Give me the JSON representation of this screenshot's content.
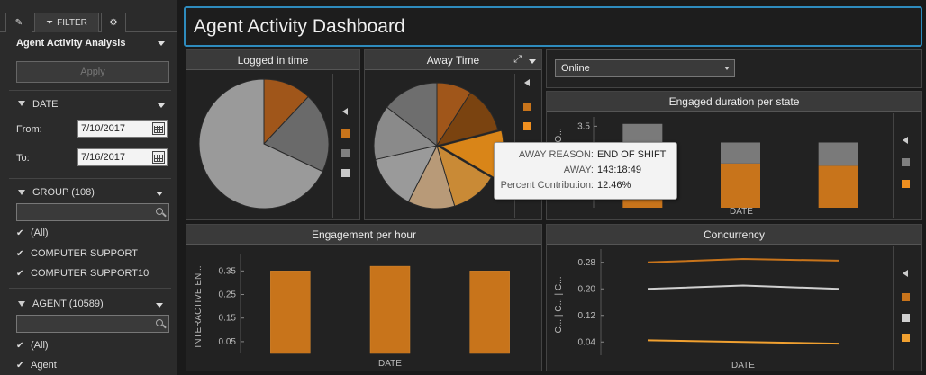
{
  "sidebar": {
    "tabs": [
      {
        "label": "",
        "icon": "pencil-icon"
      },
      {
        "label": "FILTER",
        "icon": "funnel-icon"
      },
      {
        "label": "",
        "icon": "gear-icon"
      }
    ],
    "title": "Agent Activity Analysis",
    "apply_label": "Apply",
    "date": {
      "label": "DATE",
      "from_label": "From:",
      "from_value": "7/10/2017",
      "to_label": "To:",
      "to_value": "7/16/2017"
    },
    "group": {
      "label": "GROUP (108)",
      "items": [
        "(All)",
        "COMPUTER SUPPORT",
        "COMPUTER SUPPORT10"
      ]
    },
    "agent": {
      "label": "AGENT (10589)",
      "items": [
        "(All)",
        "Agent"
      ]
    }
  },
  "header": {
    "title": "Agent Activity Dashboard"
  },
  "state_select": {
    "value": "Online"
  },
  "colors": {
    "accent": "#2e8bbd",
    "orange": "#c8741b",
    "gray": "#7a7a7a",
    "light_gray": "#c8c8c8",
    "yellow_orange": "#f0a030"
  },
  "panels": {
    "logged_in": {
      "title": "Logged in time"
    },
    "away": {
      "title": "Away Time"
    },
    "engaged": {
      "title": "Engaged duration per state",
      "xlabel": "DATE",
      "ylabel": "DO...",
      "ticks": [
        "3.5"
      ]
    },
    "engagement_hour": {
      "title": "Engagement per hour",
      "xlabel": "DATE",
      "ylabel": "INTERACTIVE EN...",
      "ticks": [
        "0.35",
        "0.25",
        "0.15",
        "0.05"
      ]
    },
    "concurrency": {
      "title": "Concurrency",
      "xlabel": "DATE",
      "ylabel": "C... | C... | C...",
      "ticks": [
        "0.28",
        "0.20",
        "0.12",
        "0.04"
      ]
    }
  },
  "tooltip": {
    "rows": [
      {
        "key": "AWAY REASON:",
        "value": "END OF SHIFT"
      },
      {
        "key": "AWAY:",
        "value": "143:18:49"
      },
      {
        "key": "Percent Contribution:",
        "value": "12.46%"
      }
    ]
  },
  "chart_data": [
    {
      "type": "pie",
      "title": "Logged in time",
      "slices": [
        {
          "value": 12,
          "color": "#a0561a"
        },
        {
          "value": 20,
          "color": "#6a6a6a"
        },
        {
          "value": 68,
          "color": "#9a9a9a"
        }
      ]
    },
    {
      "type": "pie",
      "title": "Away Time",
      "slices": [
        {
          "value": 9,
          "color": "#a0561a"
        },
        {
          "value": 12,
          "color": "#7a4310"
        },
        {
          "value": 12.46,
          "color": "#d98518"
        },
        {
          "value": 12,
          "color": "#c98a36"
        },
        {
          "value": 12,
          "color": "#b89a78"
        },
        {
          "value": 14,
          "color": "#9a9a9a"
        },
        {
          "value": 14,
          "color": "#8a8a8a"
        },
        {
          "value": 14.54,
          "color": "#6e6e6e"
        }
      ]
    },
    {
      "type": "bar",
      "title": "Engaged duration per state",
      "categories": [
        "",
        "",
        ""
      ],
      "series": [
        {
          "values": [
            2.2,
            1.9,
            1.8
          ],
          "color": "#c8741b"
        },
        {
          "values": [
            1.4,
            0.9,
            1.0
          ],
          "color": "#7a7a7a"
        }
      ],
      "ylim": [
        0,
        3.9
      ],
      "xlabel": "DATE",
      "ylabel": "DO..."
    },
    {
      "type": "bar",
      "title": "Engagement per hour",
      "categories": [
        "",
        "",
        ""
      ],
      "values": [
        0.35,
        0.37,
        0.35
      ],
      "ylim": [
        0,
        0.42
      ],
      "xlabel": "DATE",
      "ylabel": "INTERACTIVE EN..."
    },
    {
      "type": "line",
      "title": "Concurrency",
      "x": [
        "",
        "",
        ""
      ],
      "series": [
        {
          "values": [
            0.28,
            0.29,
            0.285
          ],
          "color": "#c8741b"
        },
        {
          "values": [
            0.2,
            0.21,
            0.2
          ],
          "color": "#d0d0d0"
        },
        {
          "values": [
            0.045,
            0.04,
            0.035
          ],
          "color": "#f0a030"
        }
      ],
      "ylim": [
        0,
        0.32
      ],
      "xlabel": "DATE",
      "ylabel": "C... | C... | C..."
    }
  ]
}
